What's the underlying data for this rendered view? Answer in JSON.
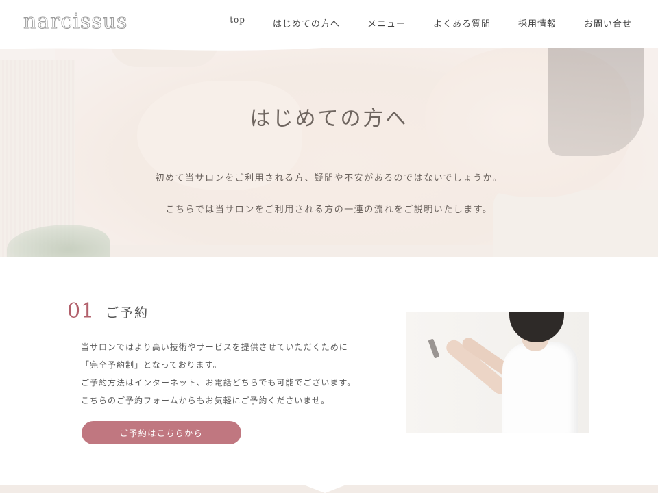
{
  "header": {
    "logo_text": "narcissus",
    "nav": [
      {
        "label": "top"
      },
      {
        "label": "はじめての方へ"
      },
      {
        "label": "メニュー"
      },
      {
        "label": "よくある質問"
      },
      {
        "label": "採用情報"
      },
      {
        "label": "お問い合せ"
      }
    ]
  },
  "hero": {
    "title": "はじめての方へ",
    "line1": "初めて当サロンをご利用される方、疑問や不安があるのではないでしょうか。",
    "line2": "こちらでは当サロンをご利用される方の一連の流れをご説明いたします。"
  },
  "section1": {
    "number": "01",
    "title": "ご予約",
    "body": [
      "当サロンではより高い技術やサービスを提供させていただくために",
      "「完全予約制」となっております。",
      "ご予約方法はインターネット、お電話どちらでも可能でございます。",
      "こちらのご予約フォームからもお気軽にご予約くださいませ。"
    ],
    "button_label": "ご予約はこちらから"
  },
  "colors": {
    "accent": "#c07780",
    "number": "#b2606b",
    "footer_band": "#f2ebe6"
  }
}
